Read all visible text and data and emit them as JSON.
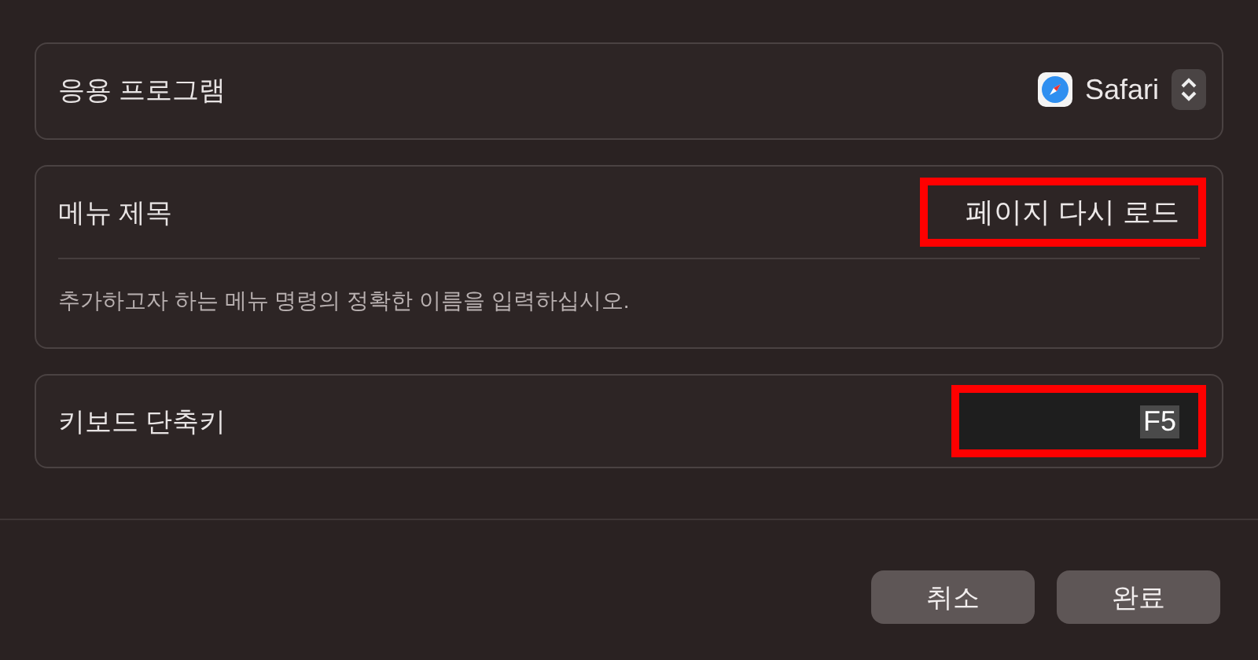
{
  "application": {
    "label": "응용 프로그램",
    "value": "Safari"
  },
  "menu_title": {
    "label": "메뉴 제목",
    "value": "페이지 다시 로드",
    "highlighted": true,
    "hint": "추가하고자 하는 메뉴 명령의 정확한 이름을 입력하십시오."
  },
  "shortcut": {
    "label": "키보드 단축키",
    "value": "F5",
    "highlighted": true
  },
  "buttons": [
    "취소",
    "완료"
  ]
}
